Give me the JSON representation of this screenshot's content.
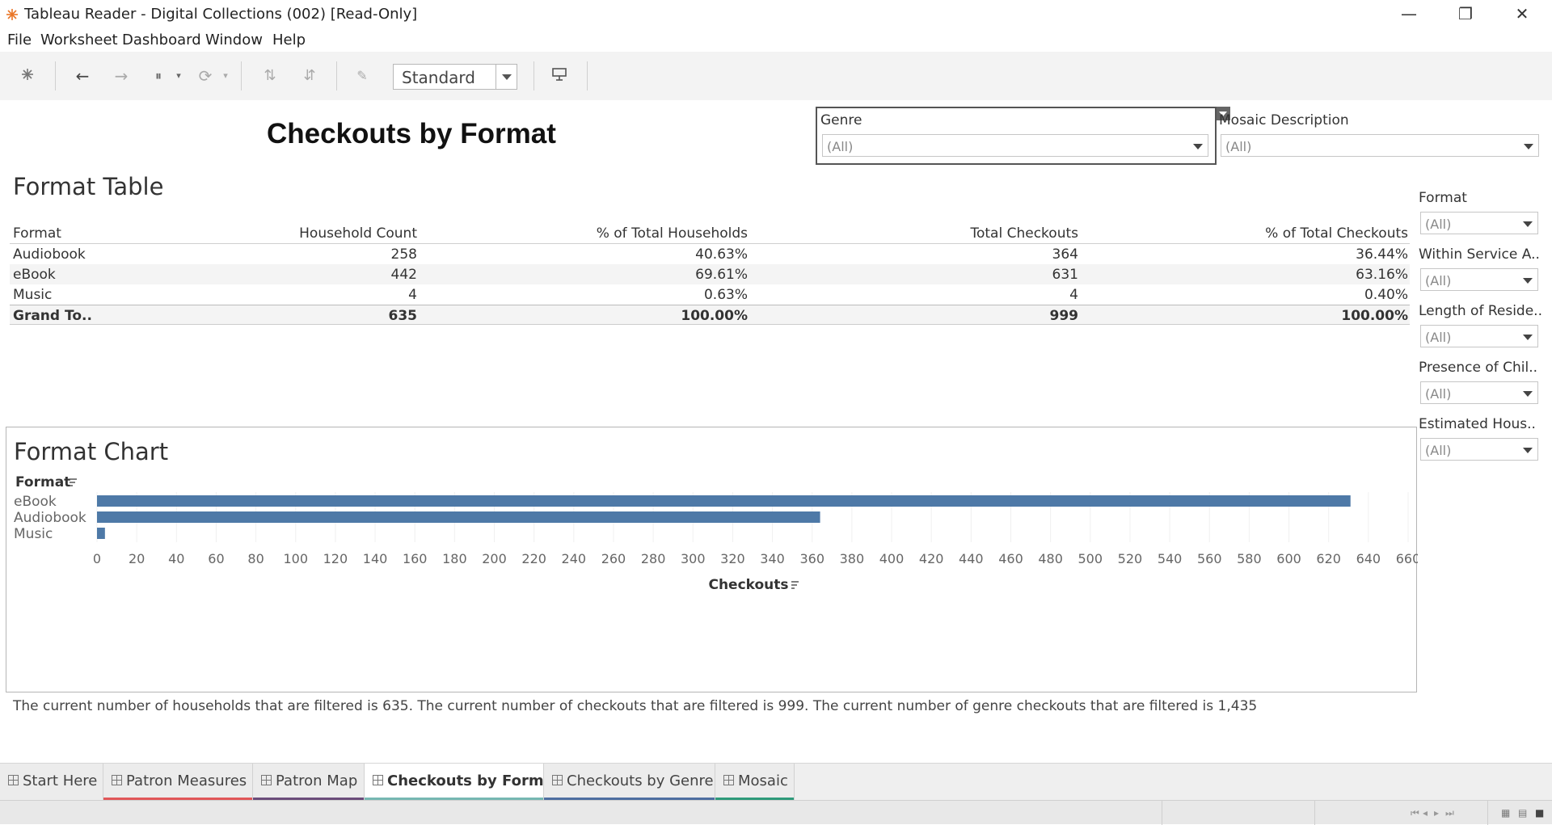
{
  "window": {
    "title": "Tableau Reader - Digital Collections (002) [Read-Only]",
    "minimize": "—",
    "restore": "❐",
    "close": "✕"
  },
  "menu": [
    "File",
    "Worksheet",
    "Dashboard",
    "Window",
    "Help"
  ],
  "toolbar": {
    "icons": [
      "tableau-logo-icon",
      "undo-icon",
      "redo-icon",
      "pause-icon",
      "refresh-icon",
      "sort-ascending-icon",
      "sort-descending-icon",
      "pin-icon",
      "presentation-icon"
    ],
    "view_mode": "Standard"
  },
  "dashboard": {
    "title": "Checkouts by Format",
    "summary": "The current number of households that are filtered is 635. The current number of checkouts that are filtered is 999. The current number of genre checkouts that are filtered is 1,435"
  },
  "filters": {
    "genre": {
      "label": "Genre",
      "value": "(All)"
    },
    "mosaic": {
      "label": "Mosaic Description",
      "value": "(All)"
    },
    "format": {
      "label": "Format",
      "value": "(All)"
    },
    "within_service": {
      "label": "Within Service A..",
      "value": "(All)"
    },
    "length_residence": {
      "label": "Length of Reside..",
      "value": "(All)"
    },
    "presence_children": {
      "label": "Presence of Chil..",
      "value": "(All)"
    },
    "estimated_household": {
      "label": "Estimated Hous..",
      "value": "(All)"
    }
  },
  "format_table": {
    "title": "Format Table",
    "columns": [
      "Format",
      "Household Count",
      "% of Total Households",
      "Total Checkouts",
      "% of Total Checkouts"
    ],
    "rows": [
      [
        "Audiobook",
        "258",
        "40.63%",
        "364",
        "36.44%"
      ],
      [
        "eBook",
        "442",
        "69.61%",
        "631",
        "63.16%"
      ],
      [
        "Music",
        "4",
        "0.63%",
        "4",
        "0.40%"
      ]
    ],
    "total": [
      "Grand To..",
      "635",
      "100.00%",
      "999",
      "100.00%"
    ]
  },
  "format_chart": {
    "title": "Format Chart",
    "row_header": "Format",
    "x_label": "Checkouts"
  },
  "chart_data": {
    "type": "bar",
    "orientation": "horizontal",
    "title": "Format Chart",
    "categories": [
      "eBook",
      "Audiobook",
      "Music"
    ],
    "values": [
      631,
      364,
      4
    ],
    "xlabel": "Checkouts",
    "ylabel": "Format",
    "xlim": [
      0,
      660
    ],
    "xticks": [
      0,
      20,
      40,
      60,
      80,
      100,
      120,
      140,
      160,
      180,
      200,
      220,
      240,
      260,
      280,
      300,
      320,
      340,
      360,
      380,
      400,
      420,
      440,
      460,
      480,
      500,
      520,
      540,
      560,
      580,
      600,
      620,
      640,
      660
    ],
    "bar_color": "#4e79a7",
    "grid": true
  },
  "tabs": [
    {
      "label": "Start Here",
      "color": "#ececec",
      "active": false
    },
    {
      "label": "Patron Measures",
      "color": "#e15759",
      "active": false
    },
    {
      "label": "Patron Map",
      "color": "#6b4c7a",
      "active": false
    },
    {
      "label": "Checkouts by Format",
      "color": "#76b7b2",
      "active": true
    },
    {
      "label": "Checkouts by Genre",
      "color": "#4e6fa1",
      "active": false
    },
    {
      "label": "Mosaic",
      "color": "#2e9a7a",
      "active": false
    }
  ],
  "status": {
    "nav_icons": [
      "first-icon",
      "prev-icon",
      "next-icon",
      "last-icon"
    ],
    "view_icons": [
      "sheet-sorter-icon",
      "filmstrip-icon",
      "tabs-icon"
    ]
  }
}
